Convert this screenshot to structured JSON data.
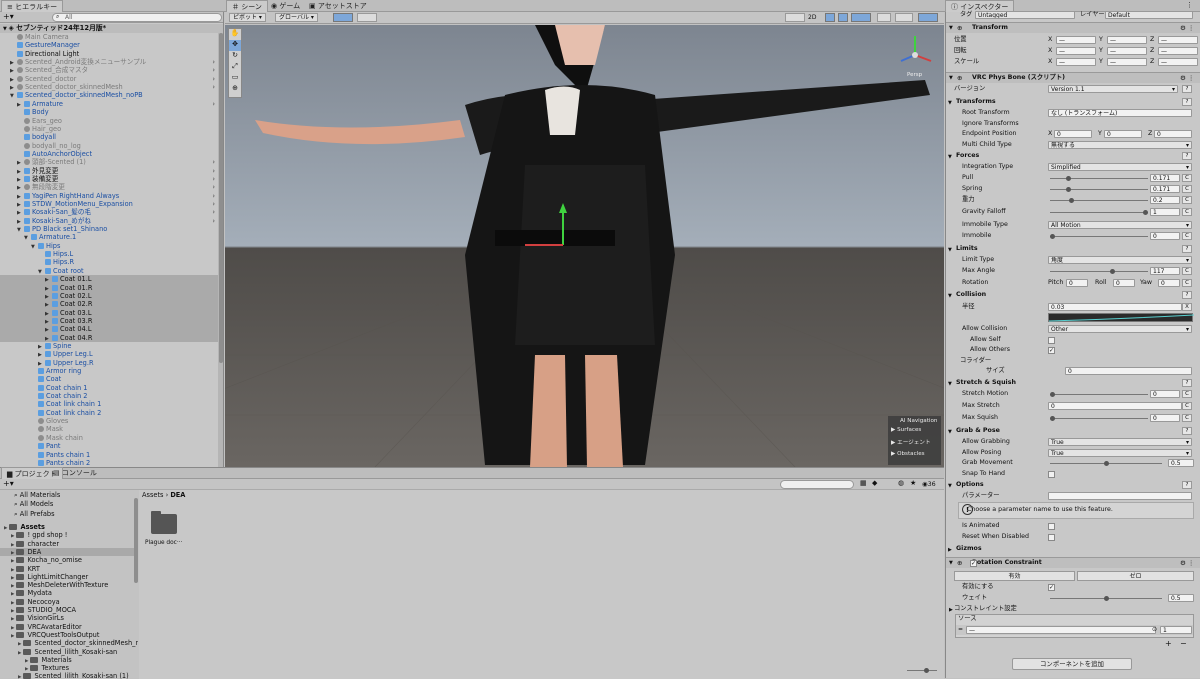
{
  "top_tabs": {
    "hierarchy": "ヒエラルキー",
    "scene": "シーン",
    "game": "ゲーム",
    "asset_store": "アセットストア",
    "inspector": "インスペクター"
  },
  "hierarchy": {
    "search_placeholder": "All",
    "scene_name": "セブンティッド24年12月版*",
    "rows": [
      {
        "label": "Main Camera",
        "d": 1,
        "c": "gray",
        "arrow": ""
      },
      {
        "label": "GestureManager",
        "d": 1,
        "c": "blue",
        "arrow": ""
      },
      {
        "label": "Directional Light",
        "d": 1,
        "c": "dark",
        "arrow": ""
      },
      {
        "label": "Scented_Android変換メニューサンプル",
        "d": 1,
        "c": "gray",
        "arrow": "▶"
      },
      {
        "label": "Scented_合成マスタ",
        "d": 1,
        "c": "gray",
        "arrow": "▶"
      },
      {
        "label": "Scented_doctor",
        "d": 1,
        "c": "gray",
        "arrow": "▶"
      },
      {
        "label": "Scented_doctor_skinnedMesh",
        "d": 1,
        "c": "gray",
        "arrow": "▶"
      },
      {
        "label": "Scented_doctor_skinnedMesh_noPB",
        "d": 1,
        "c": "blue",
        "arrow": "▼"
      },
      {
        "label": "Armature",
        "d": 2,
        "c": "blue",
        "arrow": "▶"
      },
      {
        "label": "Body",
        "d": 2,
        "c": "blue",
        "arrow": ""
      },
      {
        "label": "Ears_geo",
        "d": 2,
        "c": "gray",
        "arrow": ""
      },
      {
        "label": "Hair_geo",
        "d": 2,
        "c": "gray",
        "arrow": ""
      },
      {
        "label": "bodyall",
        "d": 2,
        "c": "blue",
        "arrow": ""
      },
      {
        "label": "bodyall_no_log",
        "d": 2,
        "c": "gray",
        "arrow": ""
      },
      {
        "label": "AutoAnchorObject",
        "d": 2,
        "c": "blue",
        "arrow": ""
      },
      {
        "label": "頭部-Scented (1)",
        "d": 2,
        "c": "gray",
        "arrow": "▶"
      },
      {
        "label": "外見変更",
        "d": 2,
        "c": "dark",
        "arrow": "▶"
      },
      {
        "label": "装備変更",
        "d": 2,
        "c": "dark",
        "arrow": "▶"
      },
      {
        "label": "無段階変更",
        "d": 2,
        "c": "gray",
        "arrow": "▶"
      },
      {
        "label": "YagiPen RightHand Always",
        "d": 2,
        "c": "blue",
        "arrow": "▶"
      },
      {
        "label": "STDW_MotionMenu_Expansion",
        "d": 2,
        "c": "blue",
        "arrow": "▶"
      },
      {
        "label": "Kosaki-San_髪の毛",
        "d": 2,
        "c": "blue",
        "arrow": "▶"
      },
      {
        "label": "Kosaki-San_めがね",
        "d": 2,
        "c": "blue",
        "arrow": "▶"
      },
      {
        "label": "PD Black set1_Shinano",
        "d": 2,
        "c": "blue",
        "arrow": "▼"
      },
      {
        "label": "Armature.1",
        "d": 3,
        "c": "blue",
        "arrow": "▼"
      },
      {
        "label": "Hips",
        "d": 4,
        "c": "blue",
        "arrow": "▼"
      },
      {
        "label": "Hips.L",
        "d": 5,
        "c": "blue",
        "arrow": ""
      },
      {
        "label": "Hips.R",
        "d": 5,
        "c": "blue",
        "arrow": ""
      },
      {
        "label": "Coat root",
        "d": 5,
        "c": "blue",
        "arrow": "▼"
      },
      {
        "label": "Coat 01.L",
        "d": 6,
        "c": "dark",
        "arrow": "▶",
        "sel": true
      },
      {
        "label": "Coat 01.R",
        "d": 6,
        "c": "dark",
        "arrow": "▶",
        "sel": true
      },
      {
        "label": "Coat 02.L",
        "d": 6,
        "c": "dark",
        "arrow": "▶",
        "sel": true
      },
      {
        "label": "Coat 02.R",
        "d": 6,
        "c": "dark",
        "arrow": "▶",
        "sel": true
      },
      {
        "label": "Coat 03.L",
        "d": 6,
        "c": "dark",
        "arrow": "▶",
        "sel": true
      },
      {
        "label": "Coat 03.R",
        "d": 6,
        "c": "dark",
        "arrow": "▶",
        "sel": true
      },
      {
        "label": "Coat 04.L",
        "d": 6,
        "c": "dark",
        "arrow": "▶",
        "sel": true
      },
      {
        "label": "Coat 04.R",
        "d": 6,
        "c": "dark",
        "arrow": "▶",
        "sel": true
      },
      {
        "label": "Spine",
        "d": 5,
        "c": "blue",
        "arrow": "▶"
      },
      {
        "label": "Upper Leg.L",
        "d": 5,
        "c": "blue",
        "arrow": "▶"
      },
      {
        "label": "Upper Leg.R",
        "d": 5,
        "c": "blue",
        "arrow": "▶"
      },
      {
        "label": "Armor ring",
        "d": 4,
        "c": "blue",
        "arrow": ""
      },
      {
        "label": "Coat",
        "d": 4,
        "c": "blue",
        "arrow": ""
      },
      {
        "label": "Coat chain 1",
        "d": 4,
        "c": "blue",
        "arrow": ""
      },
      {
        "label": "Coat chain 2",
        "d": 4,
        "c": "blue",
        "arrow": ""
      },
      {
        "label": "Coat link chain 1",
        "d": 4,
        "c": "blue",
        "arrow": ""
      },
      {
        "label": "Coat link chain 2",
        "d": 4,
        "c": "blue",
        "arrow": ""
      },
      {
        "label": "Gloves",
        "d": 4,
        "c": "gray",
        "arrow": ""
      },
      {
        "label": "Mask",
        "d": 4,
        "c": "gray",
        "arrow": ""
      },
      {
        "label": "Mask chain",
        "d": 4,
        "c": "gray",
        "arrow": ""
      },
      {
        "label": "Pant",
        "d": 4,
        "c": "blue",
        "arrow": ""
      },
      {
        "label": "Pants chain 1",
        "d": 4,
        "c": "blue",
        "arrow": ""
      },
      {
        "label": "Pants chain 2",
        "d": 4,
        "c": "blue",
        "arrow": ""
      }
    ]
  },
  "scene": {
    "pivot": "ピボット",
    "global": "グローバル",
    "mode_2d": "2D",
    "persp": "Persp",
    "ai_nav": {
      "title": "AI Navigation",
      "items": [
        "Surfaces",
        "エージェント",
        "Obstacles"
      ]
    }
  },
  "project": {
    "tab_project": "プロジェクト",
    "tab_console": "コンソール",
    "breadcrumb_root": "Assets",
    "breadcrumb_sep": "›",
    "breadcrumb_current": "DEA",
    "count": "36",
    "folder_item": "Plague doc···",
    "favorites": [
      "All Materials",
      "All Models",
      "All Prefabs"
    ],
    "tree": [
      {
        "label": "Assets",
        "d": 0,
        "bold": true
      },
      {
        "label": "! gpd shop !",
        "d": 1
      },
      {
        "label": "character",
        "d": 1
      },
      {
        "label": "DEA",
        "d": 1,
        "sel": true
      },
      {
        "label": "Kocha_no_omise",
        "d": 1
      },
      {
        "label": "KRT",
        "d": 1
      },
      {
        "label": "LightLimitChanger",
        "d": 1
      },
      {
        "label": "MeshDeleterWithTexture",
        "d": 1
      },
      {
        "label": "Mydata",
        "d": 1
      },
      {
        "label": "Necocoya",
        "d": 1
      },
      {
        "label": "STUDIO_MOCA",
        "d": 1
      },
      {
        "label": "VisionGirLs",
        "d": 1
      },
      {
        "label": "VRCAvatarEditor",
        "d": 1
      },
      {
        "label": "VRCQuestToolsOutput",
        "d": 1
      },
      {
        "label": "Scented_doctor_skinnedMesh_no",
        "d": 2
      },
      {
        "label": "Scented_lilith_Kosaki-san",
        "d": 2
      },
      {
        "label": "Materials",
        "d": 3
      },
      {
        "label": "Textures",
        "d": 3
      },
      {
        "label": "Scented_lilith_Kosaki-san (1)",
        "d": 2
      }
    ]
  },
  "inspector": {
    "tag_label": "タグ",
    "tag": "Untagged",
    "layer_label": "レイヤー",
    "layer": "Default",
    "transform": {
      "title": "Transform",
      "position": "位置",
      "rotation": "回転",
      "scale": "スケール",
      "x": "X",
      "y": "Y",
      "z": "Z",
      "dash": "—"
    },
    "physbone": {
      "title": "VRC Phys Bone (スクリプト)",
      "version_label": "バージョン",
      "version": "Version 1.1",
      "transforms": "Transforms",
      "root_transform": "Root Transform",
      "root_value": "なし (トランスフォーム)",
      "ignore_transforms": "Ignore Transforms",
      "endpoint": "Endpoint Position",
      "endpoint_x": "0",
      "endpoint_y": "0",
      "endpoint_z": "0",
      "multi_child": "Multi Child Type",
      "multi_child_val": "無視する",
      "forces": "Forces",
      "integration": "Integration Type",
      "integration_val": "Simplified",
      "pull": "Pull",
      "pull_val": "0.171",
      "spring": "Spring",
      "spring_val": "0.171",
      "gravity": "重力",
      "gravity_val": "0.2",
      "gravity_falloff": "Gravity Falloff",
      "gravity_falloff_val": "1",
      "immobile_type": "Immobile Type",
      "immobile_type_val": "All Motion",
      "immobile": "Immobile",
      "immobile_val": "0",
      "limits": "Limits",
      "limit_type": "Limit Type",
      "limit_type_val": "角度",
      "max_angle": "Max Angle",
      "max_angle_val": "117",
      "rotation": "Rotation",
      "pitch": "Pitch",
      "pitch_val": "0",
      "roll": "Roll",
      "roll_val": "0",
      "yaw": "Yaw",
      "yaw_val": "0",
      "collision": "Collision",
      "radius": "半径",
      "radius_val": "0.03",
      "allow_collision": "Allow Collision",
      "allow_collision_val": "Other",
      "allow_self": "Allow Self",
      "allow_others": "Allow Others",
      "colliders": "コライダー",
      "size": "サイズ",
      "size_val": "0",
      "stretch": "Stretch & Squish",
      "stretch_motion": "Stretch Motion",
      "stretch_motion_val": "0",
      "max_stretch": "Max Stretch",
      "max_stretch_val": "0",
      "max_squish": "Max Squish",
      "max_squish_val": "0",
      "grab": "Grab & Pose",
      "allow_grabbing": "Allow Grabbing",
      "allow_grabbing_val": "True",
      "allow_posing": "Allow Posing",
      "allow_posing_val": "True",
      "grab_movement": "Grab Movement",
      "grab_movement_val": "0.5",
      "snap": "Snap To Hand",
      "options": "Options",
      "parameter": "パラメーター",
      "info": "Choose a parameter name to use this feature.",
      "is_animated": "Is Animated",
      "reset": "Reset When Disabled",
      "gizmos": "Gizmos",
      "c": "C",
      "x_btn": "X"
    },
    "rotation_constraint": {
      "title": "Rotation Constraint",
      "activate": "有効",
      "zero": "ゼロ",
      "enabled": "有効にする",
      "weight": "ウェイト",
      "weight_val": "0.5",
      "settings": "コンストレイント設定",
      "sources": "ソース",
      "source_val": "1",
      "none": "—"
    },
    "add_component": "コンポーネントを追加"
  },
  "values": {
    "pull": 0.171,
    "spring": 0.171,
    "gravity": 0.2,
    "gravity_falloff": 1,
    "immobile": 0,
    "max_angle": 117,
    "stretch_motion": 0,
    "max_squish": 0,
    "grab_movement": 0.5,
    "weight": 0.5
  }
}
